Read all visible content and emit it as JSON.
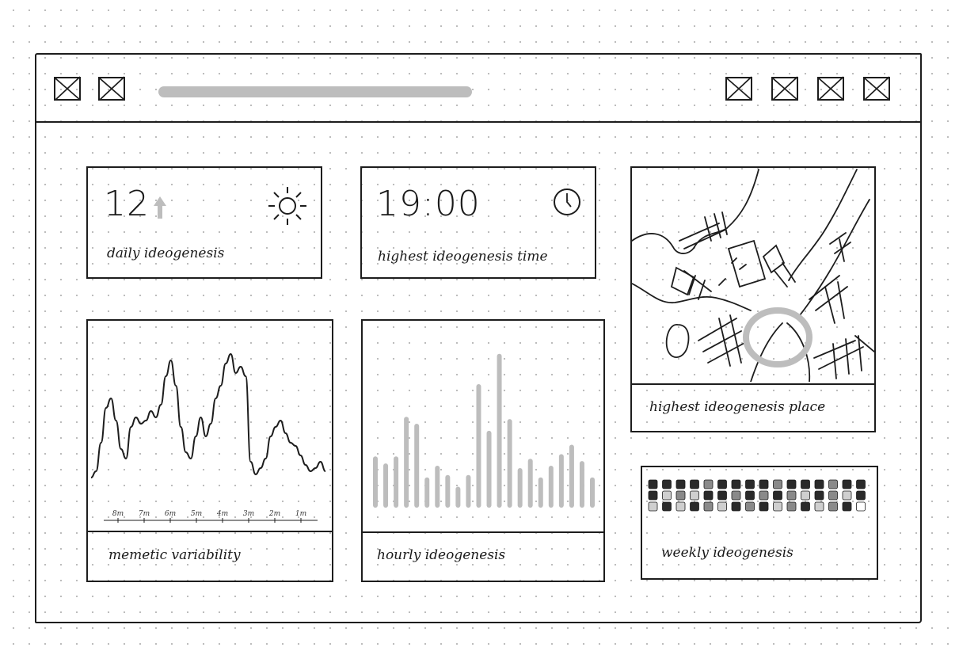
{
  "toolbar": {
    "left_icons": [
      "placeholder-image-icon",
      "placeholder-image-icon"
    ],
    "right_icons": [
      "placeholder-image-icon",
      "placeholder-image-icon",
      "placeholder-image-icon",
      "placeholder-image-icon"
    ]
  },
  "cards": {
    "daily": {
      "value": "12",
      "label": "daily ideogenesis",
      "trend_icon": "arrow-up-icon",
      "weather_icon": "sun-icon"
    },
    "time": {
      "value": "19:00",
      "label": "highest ideogenesis time",
      "icon": "clock-icon"
    },
    "map": {
      "label": "highest ideogenesis place",
      "icon": "map-sketch"
    },
    "memetic": {
      "label": "memetic variability"
    },
    "hourly": {
      "label": "hourly ideogenesis"
    },
    "weekly": {
      "label": "weekly ideogenesis"
    }
  },
  "chart_data": [
    {
      "type": "line",
      "title": "memetic variability",
      "x": [
        0,
        1,
        2,
        3,
        4,
        5,
        6,
        7,
        8,
        9,
        10,
        11,
        12,
        13,
        14,
        15,
        16,
        17,
        18,
        19,
        20,
        21,
        22,
        23,
        24,
        25,
        26,
        27,
        28,
        29,
        30,
        31,
        32,
        33,
        34,
        35,
        36,
        37,
        38,
        39,
        40,
        41,
        42,
        43,
        44,
        45,
        46,
        47
      ],
      "values": [
        8,
        12,
        30,
        52,
        58,
        44,
        26,
        20,
        40,
        46,
        42,
        44,
        50,
        46,
        54,
        72,
        82,
        66,
        40,
        24,
        20,
        34,
        46,
        34,
        42,
        58,
        66,
        80,
        86,
        74,
        78,
        72,
        18,
        10,
        14,
        20,
        34,
        40,
        44,
        36,
        30,
        28,
        22,
        16,
        12,
        14,
        18,
        12
      ],
      "tick_labels": [
        "8m",
        "7m",
        "6m",
        "5m",
        "4m",
        "3m",
        "2m",
        "1m"
      ],
      "ylim": [
        0,
        100
      ]
    },
    {
      "type": "bar",
      "title": "hourly ideogenesis",
      "values": [
        44,
        38,
        44,
        78,
        72,
        26,
        36,
        28,
        18,
        28,
        106,
        66,
        132,
        76,
        34,
        42,
        26,
        36,
        46,
        54,
        40,
        26
      ],
      "color": "#bdbdbd",
      "ylim": [
        0,
        140
      ]
    },
    {
      "type": "heatmap",
      "title": "weekly ideogenesis",
      "rows": 3,
      "cols": 16,
      "values": [
        [
          3,
          3,
          3,
          3,
          2,
          3,
          3,
          3,
          3,
          2,
          3,
          3,
          3,
          2,
          3,
          3
        ],
        [
          3,
          1,
          2,
          1,
          3,
          3,
          2,
          3,
          2,
          3,
          2,
          1,
          3,
          2,
          1,
          3
        ],
        [
          1,
          3,
          1,
          3,
          2,
          1,
          3,
          2,
          3,
          1,
          2,
          3,
          1,
          2,
          3,
          0
        ]
      ],
      "levels": [
        "#ffffff",
        "#cfcfcf",
        "#8a8a8a",
        "#2a2a2a"
      ]
    }
  ]
}
